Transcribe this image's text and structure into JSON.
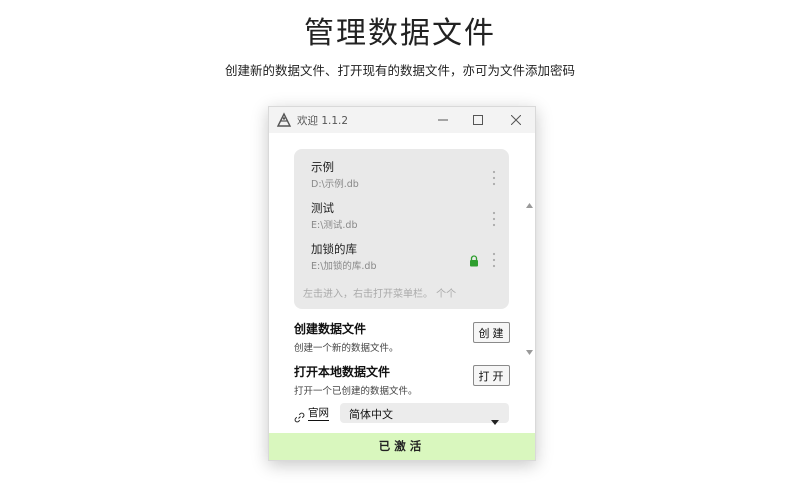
{
  "hero": {
    "title": "管理数据文件",
    "subtitle": "创建新的数据文件、打开现有的数据文件，亦可为文件添加密码"
  },
  "window": {
    "title": "欢迎 1.1.2",
    "controls": [
      "minimize-icon",
      "maximize-icon",
      "close-icon"
    ]
  },
  "files": [
    {
      "name": "示例",
      "path": "D:\\示例.db",
      "locked": false
    },
    {
      "name": "测试",
      "path": "E:\\测试.db",
      "locked": false
    },
    {
      "name": "加锁的库",
      "path": "E:\\加锁的库.db",
      "locked": true
    }
  ],
  "file_list_hint": "左击进入，右击打开菜单栏。 个个",
  "actions": {
    "create": {
      "title": "创建数据文件",
      "desc": "创建一个新的数据文件。",
      "button": "创建"
    },
    "open": {
      "title": "打开本地数据文件",
      "desc": "打开一个已创建的数据文件。",
      "button": "打开"
    }
  },
  "footer": {
    "website_link": "官网",
    "language_selected": "简体中文",
    "activation_status": "已激活"
  },
  "colors": {
    "activated_bg": "#d9f7be",
    "lock_icon": "#2e9e2e",
    "list_bg": "#e9e9e9"
  }
}
